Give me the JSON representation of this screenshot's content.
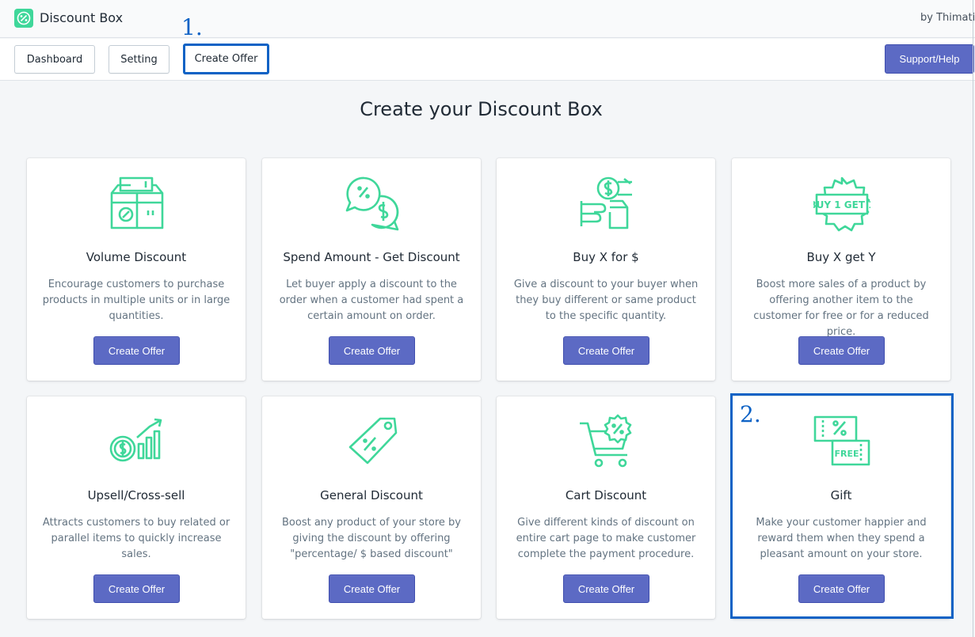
{
  "app": {
    "title": "Discount Box",
    "by": "by Thimatic",
    "brand_color": "#3fd79a",
    "logo_icon": "percent-badge-icon"
  },
  "nav": {
    "dashboard_label": "Dashboard",
    "setting_label": "Setting",
    "create_offer_label": "Create Offer",
    "support_label": "Support/Help"
  },
  "annotations": {
    "step1": "1.",
    "step2": "2.",
    "highlight_color": "#0d62c5"
  },
  "main": {
    "title": "Create your Discount Box",
    "accent_color": "#5c6ac4",
    "icon_color": "#3fd79a",
    "cards": [
      {
        "title": "Volume Discount",
        "desc": "Encourage customers to purchase products in multiple units or in large quantities.",
        "button": "Create Offer",
        "icon": "box-percent-icon"
      },
      {
        "title": "Spend Amount - Get Discount",
        "desc": "Let buyer apply a discount to the order when a customer had spent a certain amount on order.",
        "button": "Create Offer",
        "icon": "chat-dollar-icon"
      },
      {
        "title": "Buy X for $",
        "desc": "Give a discount to your buyer when they buy different or same product to the specific quantity.",
        "button": "Create Offer",
        "icon": "hand-coin-icon"
      },
      {
        "title": "Buy X get Y",
        "desc": "Boost more sales of a product by offering another item to the customer for free or for a reduced price.",
        "button": "Create Offer",
        "icon": "buy1get1-badge-icon",
        "icon_text": "BUY 1 GET 1"
      },
      {
        "title": "Upsell/Cross-sell",
        "desc": "Attracts customers to buy related or parallel items to quickly increase sales.",
        "button": "Create Offer",
        "icon": "coin-growth-chart-icon"
      },
      {
        "title": "General Discount",
        "desc": "Boost any product of your store by giving the discount by offering \"percentage/ $ based discount\"",
        "button": "Create Offer",
        "icon": "price-tag-icon"
      },
      {
        "title": "Cart Discount",
        "desc": "Give different kinds of discount on entire cart page to make customer complete the payment procedure.",
        "button": "Create Offer",
        "icon": "cart-percent-icon"
      },
      {
        "title": "Gift",
        "desc": "Make your customer happier and reward them when they spend a pleasant amount on your store.",
        "button": "Create Offer",
        "icon": "free-coupon-icon",
        "icon_text": "FREE"
      }
    ]
  }
}
